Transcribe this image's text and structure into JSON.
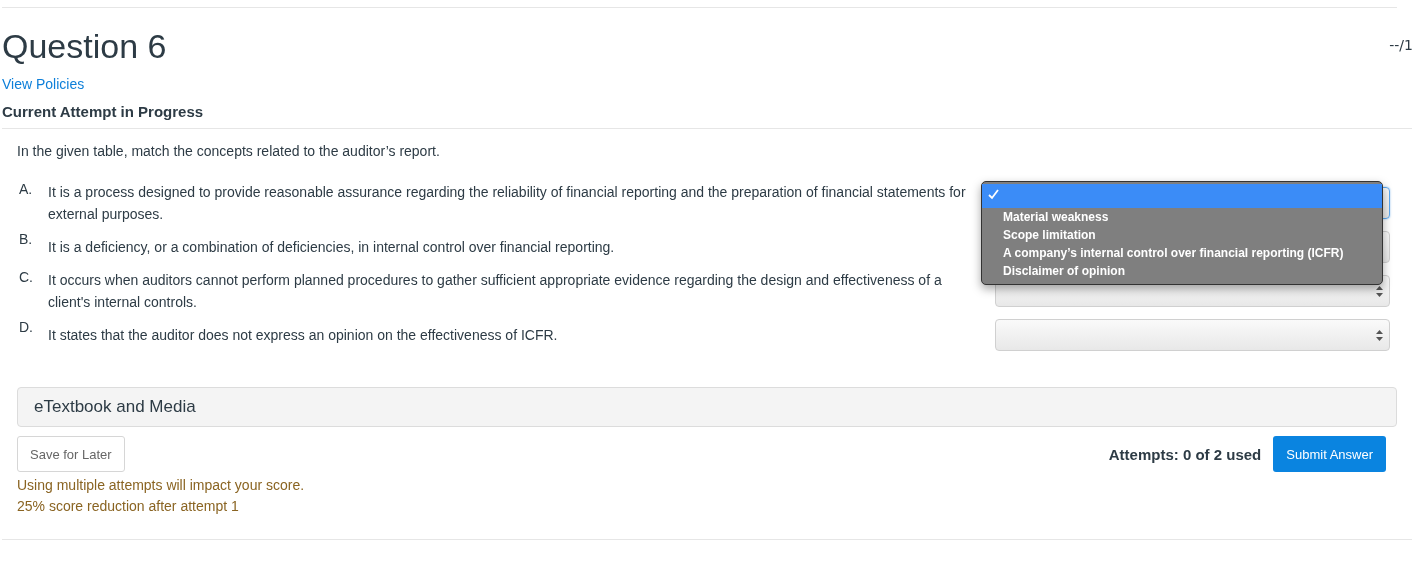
{
  "header": {
    "title": "Question 6",
    "score": "--/1",
    "policies_link": "View Policies",
    "status": "Current Attempt in Progress"
  },
  "question": {
    "prompt": "In the given table, match the concepts related to the auditor’s report.",
    "items": [
      {
        "letter": "A.",
        "text": "It is a process designed to provide reasonable assurance regarding the reliability of financial reporting and the preparation of financial statements for external purposes.",
        "focused": true
      },
      {
        "letter": "B.",
        "text": "It is a deficiency, or a combination of deficiencies, in internal control over financial reporting.",
        "focused": false
      },
      {
        "letter": "C.",
        "text": "It occurs when auditors cannot perform planned procedures to gather sufficient appropriate evidence regarding the design and effectiveness of a client's internal controls.",
        "focused": false
      },
      {
        "letter": "D.",
        "text": "It states that the auditor does not express an opinion on the effectiveness of ICFR.",
        "focused": false
      }
    ],
    "open_dropdown": {
      "options": [
        {
          "selected": true
        },
        {
          "label": "Material weakness",
          "selected": false
        },
        {
          "label": "Scope limitation",
          "selected": false
        },
        {
          "label": "A company’s internal control over financial reporting (ICFR)",
          "selected": false
        },
        {
          "label": "Disclaimer of opinion",
          "selected": false
        }
      ]
    }
  },
  "media_panel": {
    "title": "eTextbook and Media"
  },
  "footer": {
    "save_button": "Save for Later",
    "attempts": "Attempts: 0 of 2 used",
    "submit_button": "Submit Answer",
    "warnings": [
      "Using multiple attempts will impact your score.",
      "25% score reduction after attempt 1"
    ]
  }
}
